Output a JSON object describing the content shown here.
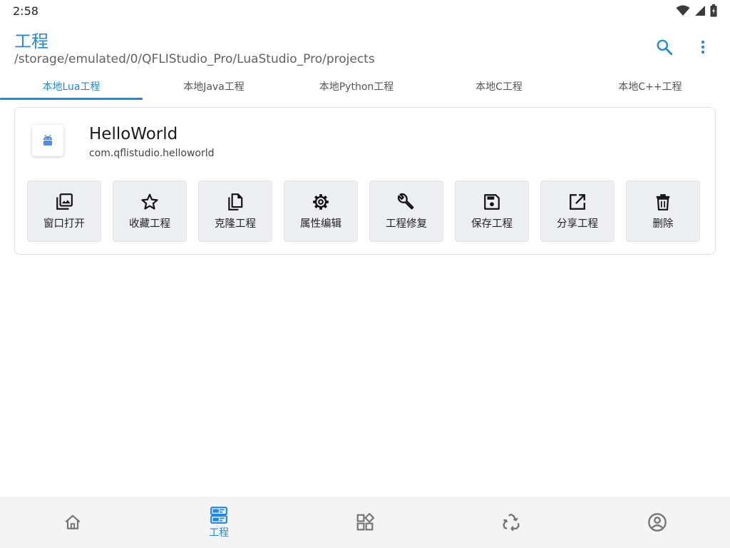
{
  "status_bar": {
    "time": "2:58"
  },
  "app_bar": {
    "title": "工程",
    "subtitle": "/storage/emulated/0/QFLIStudio_Pro/LuaStudio_Pro/projects"
  },
  "tabs": [
    {
      "label": "本地Lua工程",
      "active": true
    },
    {
      "label": "本地Java工程",
      "active": false
    },
    {
      "label": "本地Python工程",
      "active": false
    },
    {
      "label": "本地C工程",
      "active": false
    },
    {
      "label": "本地C++工程",
      "active": false
    }
  ],
  "project": {
    "name": "HelloWorld",
    "package": "com.qflistudio.helloworld",
    "actions": [
      {
        "label": "窗口打开",
        "icon": "gallery-icon"
      },
      {
        "label": "收藏工程",
        "icon": "star-icon"
      },
      {
        "label": "克隆工程",
        "icon": "copy-icon"
      },
      {
        "label": "属性编辑",
        "icon": "gear-icon"
      },
      {
        "label": "工程修复",
        "icon": "wrench-icon"
      },
      {
        "label": "保存工程",
        "icon": "save-icon"
      },
      {
        "label": "分享工程",
        "icon": "share-icon"
      },
      {
        "label": "删除",
        "icon": "trash-icon"
      }
    ]
  },
  "bottom_nav": {
    "items": [
      {
        "icon": "home-icon",
        "label": ""
      },
      {
        "icon": "projects-icon",
        "label": "工程",
        "active": true
      },
      {
        "icon": "apps-icon",
        "label": ""
      },
      {
        "icon": "recycle-icon",
        "label": ""
      },
      {
        "icon": "account-icon",
        "label": ""
      }
    ]
  },
  "colors": {
    "accent": "#1e88e5",
    "nav_bg": "#f4f4f5",
    "button_bg": "#eceef1"
  }
}
